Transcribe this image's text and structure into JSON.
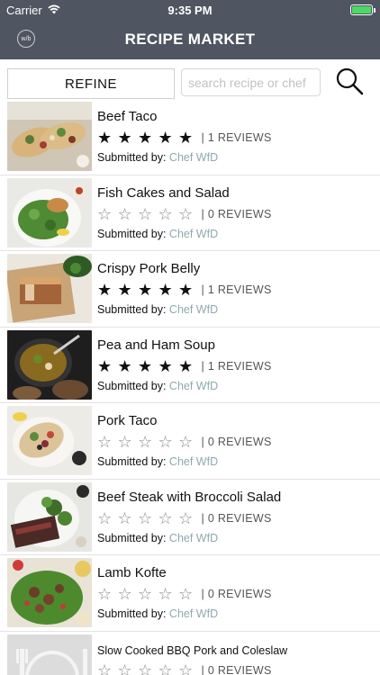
{
  "status_bar": {
    "carrier": "Carrier",
    "time": "9:35 PM"
  },
  "header": {
    "logo_text": "w/b",
    "title": "RECIPE MARKET"
  },
  "toolbar": {
    "refine_label": "REFINE",
    "search_placeholder": "search recipe or chef"
  },
  "colors": {
    "nav_bar": "#4f5661",
    "chef_link": "#8fa9ad",
    "battery": "#4cd964"
  },
  "recipes": [
    {
      "name": "Beef Taco",
      "rating": 5,
      "reviews": "| 1 REVIEWS",
      "submitted_label": "Submitted by:",
      "chef": "Chef WfD",
      "image": "beef-taco-photo"
    },
    {
      "name": "Fish Cakes and Salad",
      "rating": 0,
      "reviews": "| 0 REVIEWS",
      "submitted_label": "Submitted by:",
      "chef": "Chef WfD",
      "image": "fish-cakes-photo"
    },
    {
      "name": "Crispy Pork Belly",
      "rating": 5,
      "reviews": "| 1 REVIEWS",
      "submitted_label": "Submitted by:",
      "chef": "Chef WfD",
      "image": "pork-belly-photo"
    },
    {
      "name": "Pea and Ham Soup",
      "rating": 5,
      "reviews": "| 1 REVIEWS",
      "submitted_label": "Submitted by:",
      "chef": "Chef WfD",
      "image": "pea-soup-photo"
    },
    {
      "name": "Pork Taco",
      "rating": 0,
      "reviews": "| 0 REVIEWS",
      "submitted_label": "Submitted by:",
      "chef": "Chef WfD",
      "image": "pork-taco-photo"
    },
    {
      "name": "Beef Steak with Broccoli Salad",
      "rating": 0,
      "reviews": "| 0 REVIEWS",
      "submitted_label": "Submitted by:",
      "chef": "Chef WfD",
      "image": "beef-steak-photo"
    },
    {
      "name": "Lamb Kofte",
      "rating": 0,
      "reviews": "| 0 REVIEWS",
      "submitted_label": "Submitted by:",
      "chef": "Chef WfD",
      "image": "lamb-kofte-photo"
    },
    {
      "name": "Slow Cooked BBQ Pork and Coleslaw",
      "rating": 0,
      "reviews": "| 0 REVIEWS",
      "image": "placeholder-plate-icon"
    }
  ]
}
